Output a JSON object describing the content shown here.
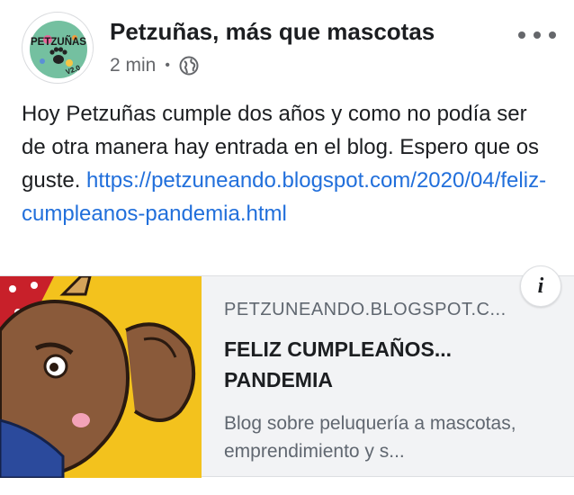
{
  "post": {
    "page_name": "Petzuñas, más que mascotas",
    "timestamp": "2 min",
    "separator": "•",
    "privacy_icon": "globe-icon",
    "more_icon": "more-dots-icon",
    "text": "Hoy Petzuñas cumple dos años y como no podía ser de otra manera hay entrada en el blog. Espero que os guste. ",
    "link_text": "https://petzuneando.blogspot.com/2020/04/feliz-cumpleanos-pandemia.html"
  },
  "avatar": {
    "logo_text": "PETZUÑAS",
    "badge_text": "V2.0"
  },
  "link_preview": {
    "domain": "PETZUNEANDO.BLOGSPOT.C...",
    "title": "FELIZ CUMPLEAÑOS... PANDEMIA",
    "description": "Blog sobre peluquería a mascotas, emprendimiento y s...",
    "info_icon": "i"
  },
  "colors": {
    "link": "#216fdb",
    "meta": "#65676b",
    "card_background": "#f2f3f5",
    "image_yellow": "#f3c21d"
  }
}
